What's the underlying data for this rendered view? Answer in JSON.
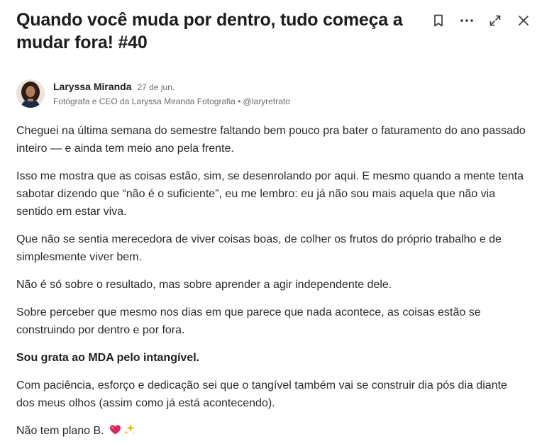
{
  "post": {
    "title": "Quando você muda por dentro, tudo começa a mudar fora! #40",
    "author": {
      "name": "Laryssa Miranda",
      "date": "27 de jun.",
      "headline": "Fotógrafa e CEO da Laryssa Miranda Fotografia • @laryretrato"
    },
    "paragraphs": [
      "Cheguei na última semana do semestre faltando bem pouco pra bater o faturamento do ano passado inteiro — e ainda tem meio ano pela frente.",
      "Isso me mostra que as coisas estão, sim, se desenrolando por aqui. E mesmo quando a mente tenta sabotar dizendo que “não é o suficiente”, eu me lembro: eu já não sou mais aquela que não via sentido em estar viva.",
      "Que não se sentia merecedora de viver coisas boas, de colher os frutos do próprio trabalho e de simplesmente viver bem.",
      "Não é só sobre o resultado, mas sobre aprender a agir independente dele.",
      "Sobre perceber que mesmo nos dias em que parece que nada acontece, as coisas estão se construindo por dentro e por fora.",
      "Sou grata ao MDA pelo intangível.",
      "Com paciência, esforço e dedicação sei que o tangível também vai se construir dia pós dia diante dos meus olhos (assim como já está acontecendo).",
      "Não tem plano B."
    ],
    "closing_emojis": [
      "heart-icon",
      "sparkles-icon"
    ]
  },
  "toolbar": {
    "icons": [
      "bookmark-icon",
      "more-icon",
      "expand-icon",
      "close-icon"
    ]
  },
  "colors": {
    "text": "#2a2a2a",
    "muted": "#6b6b6b",
    "heart": "#e0245e",
    "sparkle": "#f5b400"
  }
}
